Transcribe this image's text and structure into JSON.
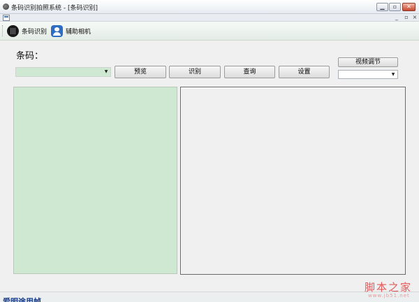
{
  "window": {
    "title": "条码识别拍照系统 - [条码识别]",
    "controls": [
      "minimize-icon",
      "restore-icon",
      "close-icon"
    ]
  },
  "mdi": {
    "buttons": [
      "_",
      "▫",
      "×"
    ]
  },
  "toolbar": {
    "items": [
      {
        "label": "条码识别",
        "icon": "barcode-icon"
      },
      {
        "label": "辅助相机",
        "icon": "camera-user-icon"
      }
    ]
  },
  "main": {
    "barcode_label": "条码：",
    "barcode_value": "",
    "buttons": {
      "preview": "预览",
      "recognize": "识别",
      "query": "查询",
      "settings": "设置",
      "video_adjust": "视频调节"
    },
    "video_select_value": ""
  },
  "status": {
    "text": "爱明途用帧"
  },
  "watermark": {
    "text": "脚本之家",
    "sub": "www.jb51.net"
  },
  "colors": {
    "panel_green": "#cfe8d1",
    "window_bg": "#f0f0f0"
  }
}
